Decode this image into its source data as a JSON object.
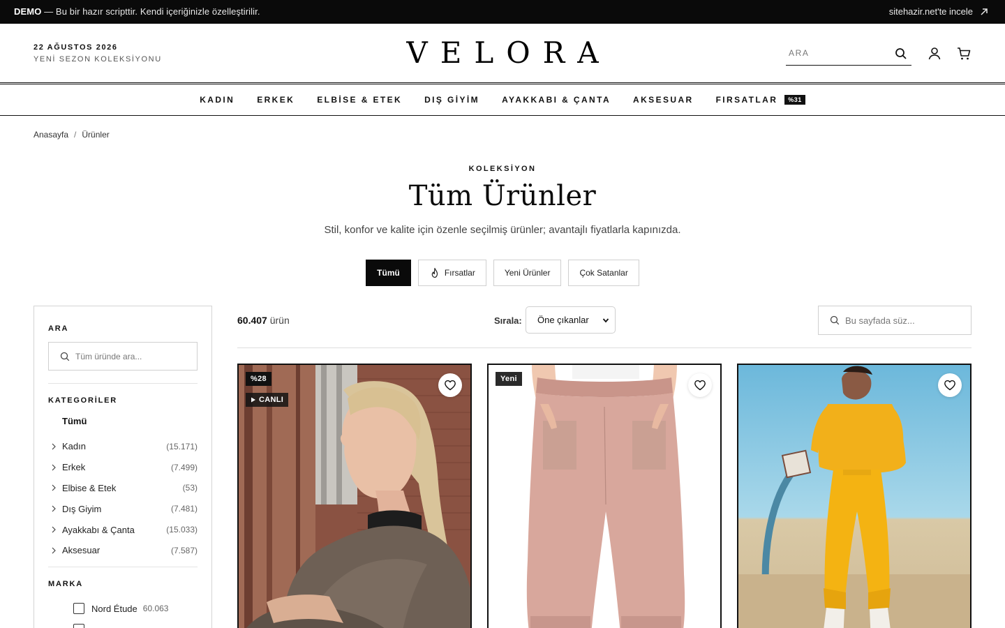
{
  "demo_bar": {
    "label": "DEMO",
    "text": "— Bu bir hazır scripttir. Kendi içeriğinizle özelleştirilir.",
    "link": "sitehazir.net'te incele"
  },
  "header": {
    "date": "22 AĞUSTOS 2026",
    "season": "YENİ SEZON KOLEKSİYONU",
    "logo": "VELORA",
    "search_placeholder": "ARA"
  },
  "nav": {
    "items": [
      {
        "label": "KADIN"
      },
      {
        "label": "ERKEK"
      },
      {
        "label": "ELBİSE & ETEK"
      },
      {
        "label": "DIŞ GİYİM"
      },
      {
        "label": "AYAKKABI & ÇANTA"
      },
      {
        "label": "AKSESUAR"
      },
      {
        "label": "FIRSATLAR",
        "badge": "%31"
      }
    ]
  },
  "breadcrumb": {
    "home": "Anasayfa",
    "separator": "/",
    "current": "Ürünler"
  },
  "hero": {
    "eyebrow": "KOLEKSİYON",
    "title": "Tüm Ürünler",
    "subtitle": "Stil, konfor ve kalite için özenle seçilmiş ürünler; avantajlı fiyatlarla kapınızda."
  },
  "tabs": [
    {
      "label": "Tümü",
      "active": true
    },
    {
      "label": "Fırsatlar",
      "icon": "flame-icon"
    },
    {
      "label": "Yeni Ürünler"
    },
    {
      "label": "Çok Satanlar"
    }
  ],
  "sidebar": {
    "search_title": "ARA",
    "search_placeholder": "Tüm üründe ara...",
    "categories_title": "KATEGORİLER",
    "all_label": "Tümü",
    "categories": [
      {
        "name": "Kadın",
        "count": "(15.171)"
      },
      {
        "name": "Erkek",
        "count": "(7.499)"
      },
      {
        "name": "Elbise & Etek",
        "count": "(53)"
      },
      {
        "name": "Dış Giyim",
        "count": "(7.481)"
      },
      {
        "name": "Ayakkabı & Çanta",
        "count": "(15.033)"
      },
      {
        "name": "Aksesuar",
        "count": "(7.587)"
      }
    ],
    "brand_title": "MARKA",
    "brands": [
      {
        "name": "Nord Étude",
        "count": "60.063"
      }
    ]
  },
  "toolbar": {
    "count": "60.407",
    "count_suffix": "ürün",
    "sort_label": "Sırala:",
    "sort_value": "Öne çıkanlar",
    "filter_placeholder": "Bu sayfada süz..."
  },
  "products": [
    {
      "badge": "%28",
      "live_badge": "CANLI"
    },
    {
      "badge": "Yeni"
    },
    {}
  ],
  "colors": {
    "primary": "#0a0a0a",
    "border": "#cfcfcf",
    "muted": "#666666"
  }
}
